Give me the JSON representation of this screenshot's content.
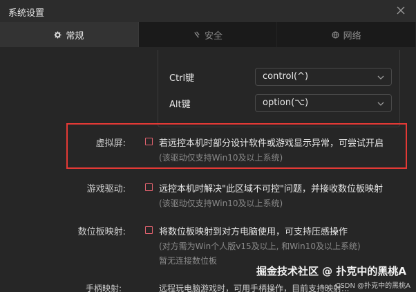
{
  "window": {
    "title": "系统设置"
  },
  "tabs": [
    {
      "label": "常规",
      "icon": "gear-icon",
      "active": true
    },
    {
      "label": "安全",
      "icon": "shield-icon",
      "active": false
    },
    {
      "label": "网络",
      "icon": "globe-icon",
      "active": false
    }
  ],
  "keymap": {
    "ctrl": {
      "label": "Ctrl键",
      "value": "control(^)"
    },
    "alt": {
      "label": "Alt键",
      "value": "option(⌥)"
    }
  },
  "settings": {
    "virtual_screen": {
      "label": "虚拟屏:",
      "checked": false,
      "description": "若远控本机时部分设计软件或游戏显示异常，可尝试开启",
      "note": "(该驱动仅支持Win10及以上系统)"
    },
    "game_driver": {
      "label": "游戏驱动:",
      "checked": false,
      "description": "远控本机时解决\"此区域不可控\"问题，并接收数位板映射",
      "note": "(该驱动仅支持Win10及以上系统)"
    },
    "tablet_mapping": {
      "label": "数位板映射:",
      "checked": false,
      "description": "将数位板映射到对方电脑使用，可支持压感操作",
      "note": "(对方需为Win个人版v15及以上, 和Win10及以上系统)",
      "status": "暂无连接数位板"
    },
    "gamepad_mapping": {
      "label": "手柄映射:",
      "description": "远程玩电脑游戏时，可用手柄操作，目前支持映射..."
    }
  },
  "watermark": {
    "main": "掘金技术社区 @ 扑克中的黑桃A",
    "sub": "CSDN @扑克中的黑桃A"
  },
  "colors": {
    "highlight_border": "#e53935",
    "checkbox_border": "#e2626f",
    "background": "#262626",
    "active_tab": "#333333"
  }
}
